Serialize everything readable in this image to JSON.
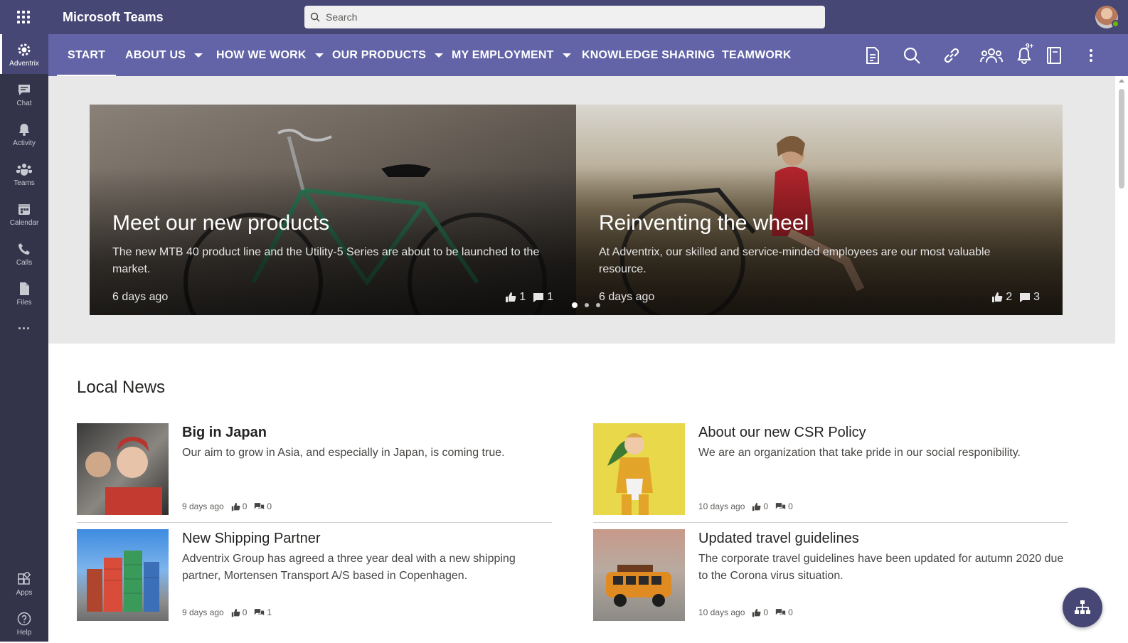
{
  "app": {
    "name": "Microsoft Teams"
  },
  "search": {
    "placeholder": "Search"
  },
  "rail": {
    "items": [
      {
        "label": "Adventrix",
        "icon": "gear-icon"
      },
      {
        "label": "Chat",
        "icon": "chat-icon"
      },
      {
        "label": "Activity",
        "icon": "bell-icon"
      },
      {
        "label": "Teams",
        "icon": "teams-icon"
      },
      {
        "label": "Calendar",
        "icon": "calendar-icon"
      },
      {
        "label": "Calls",
        "icon": "phone-icon"
      },
      {
        "label": "Files",
        "icon": "file-icon"
      }
    ],
    "more": "···",
    "bottom": [
      {
        "label": "Apps",
        "icon": "apps-icon"
      },
      {
        "label": "Help",
        "icon": "help-icon"
      }
    ]
  },
  "sitenav": {
    "items": [
      {
        "label": "START",
        "active": true
      },
      {
        "label": "ABOUT US",
        "dropdown": true
      },
      {
        "label": "HOW WE WORK",
        "dropdown": true
      },
      {
        "label": "OUR PRODUCTS",
        "dropdown": true
      },
      {
        "label": "MY EMPLOYMENT",
        "dropdown": true
      },
      {
        "label": "KNOWLEDGE SHARING"
      },
      {
        "label": "TEAMWORK"
      }
    ],
    "notification_badge": "9+"
  },
  "carousel": {
    "slides": [
      {
        "title": "Meet our new products",
        "text": "The new MTB 40 product line and the Utility-5 Series are about to be launched to the market.",
        "date": "6 days ago",
        "likes": "1",
        "comments": "1"
      },
      {
        "title": "Reinventing the wheel",
        "text": "At Adventrix, our skilled and service-minded employees are our most valuable resource.",
        "date": "6 days ago",
        "likes": "2",
        "comments": "3"
      }
    ]
  },
  "local_news": {
    "title": "Local News",
    "items": [
      {
        "title": "Big in Japan",
        "text": "Our aim to grow in Asia, and especially in Japan, is coming true.",
        "date": "9 days ago",
        "likes": "0",
        "comments": "0"
      },
      {
        "title": "About our new CSR Policy",
        "text": "We are an organization that take pride in our social responibility.",
        "date": "10 days ago",
        "likes": "0",
        "comments": "0"
      },
      {
        "title": "New Shipping Partner",
        "text": "Adventrix Group has agreed a three year deal with a new shipping partner, Mortensen Transport A/S based in Copenhagen.",
        "date": "9 days ago",
        "likes": "0",
        "comments": "1"
      },
      {
        "title": "Updated travel guidelines",
        "text": "The corporate travel guidelines have been updated for autumn 2020 due to the Corona virus situation.",
        "date": "10 days ago",
        "likes": "0",
        "comments": "0"
      }
    ]
  },
  "colors": {
    "titlebar": "#464775",
    "rail": "#33344a",
    "nav": "#6264a7"
  }
}
